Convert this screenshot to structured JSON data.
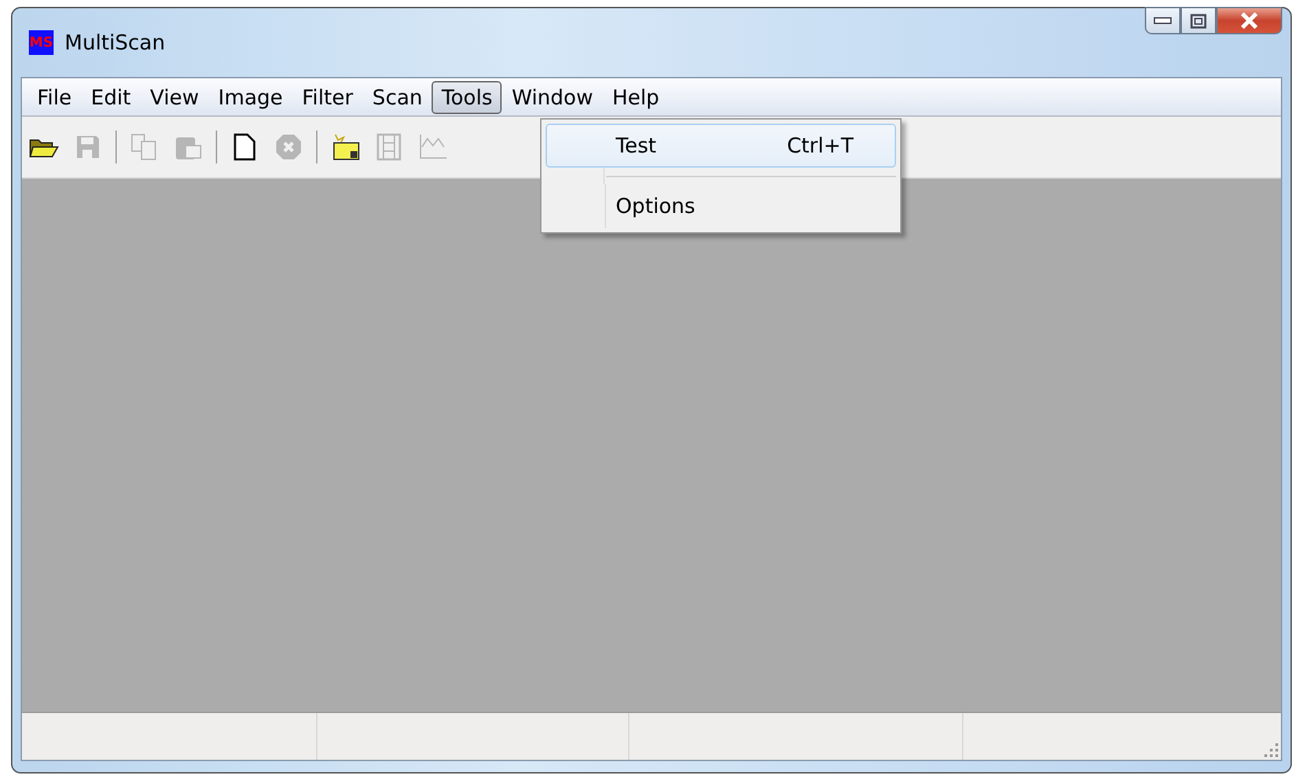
{
  "window": {
    "title": "MultiScan",
    "logo": "MS"
  },
  "menu": [
    {
      "label": "File",
      "selected": false
    },
    {
      "label": "Edit",
      "selected": false
    },
    {
      "label": "View",
      "selected": false
    },
    {
      "label": "Image",
      "selected": false
    },
    {
      "label": "Filter",
      "selected": false
    },
    {
      "label": "Scan",
      "selected": false
    },
    {
      "label": "Tools",
      "selected": true
    },
    {
      "label": "Window",
      "selected": false
    },
    {
      "label": "Help",
      "selected": false
    }
  ],
  "toolbar": [
    {
      "kind": "button",
      "disabled": false
    },
    {
      "kind": "button",
      "disabled": true
    },
    {
      "kind": "separator"
    },
    {
      "kind": "button",
      "disabled": true
    },
    {
      "kind": "button",
      "disabled": true
    },
    {
      "kind": "separator"
    },
    {
      "kind": "button",
      "disabled": false
    },
    {
      "kind": "button",
      "disabled": true
    },
    {
      "kind": "separator"
    },
    {
      "kind": "button",
      "disabled": false
    },
    {
      "kind": "button",
      "disabled": true
    },
    {
      "kind": "button",
      "disabled": true
    }
  ],
  "dropdown": [
    {
      "kind": "item",
      "label": "Test",
      "shortcut": "Ctrl+T",
      "selected": true
    },
    {
      "kind": "separator"
    },
    {
      "kind": "item",
      "label": "Options",
      "selected": false
    }
  ]
}
